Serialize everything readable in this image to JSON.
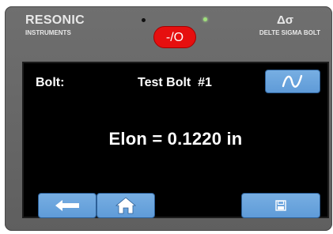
{
  "header": {
    "brand_name": "RESONIC",
    "brand_sub": "INSTRUMENTS",
    "model_symbol": "Δσ",
    "model_name": "DELTE SIGMA BOLT",
    "power_label": "-/O"
  },
  "screen": {
    "bolt_label": "Bolt:",
    "bolt_name": "Test Bolt  #1",
    "reading": "Elon = 0.1220 in"
  },
  "icons": {
    "waveform": "waveform-icon",
    "back": "left-arrow-icon",
    "home": "home-icon",
    "save": "save-icon"
  },
  "colors": {
    "button_blue": "#6aa5df",
    "power_red": "#e60f0f",
    "screen_bg": "#000000",
    "led_green": "#9fe07b"
  }
}
